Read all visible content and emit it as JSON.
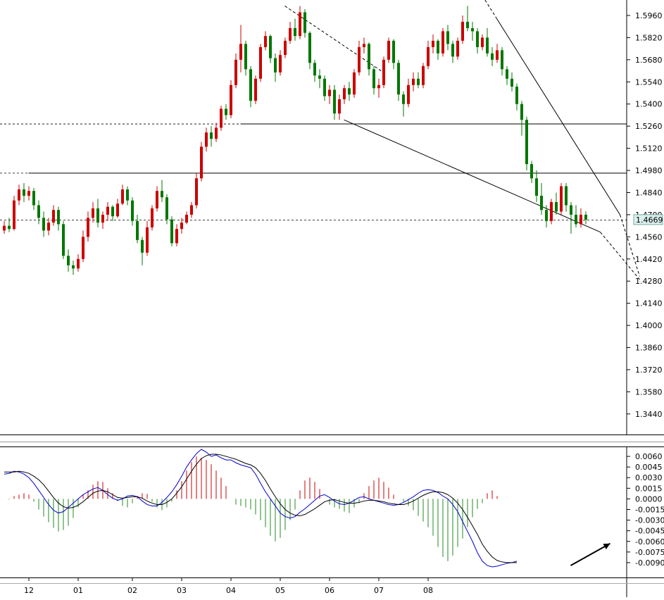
{
  "chart_data": [
    {
      "type": "candlestick",
      "panel": "price",
      "y_ticks": [
        1.596,
        1.582,
        1.568,
        1.554,
        1.54,
        1.526,
        1.512,
        1.498,
        1.484,
        1.47,
        1.456,
        1.442,
        1.428,
        1.414,
        1.4,
        1.386,
        1.372,
        1.358,
        1.344
      ],
      "ylim": [
        1.331,
        1.604
      ],
      "last_price": 1.4669,
      "last_price_label": "1.4669",
      "up_color": "#cc0000",
      "down_color": "#007700",
      "levels": [
        {
          "value": 1.5276,
          "style": "solid-then-dashed",
          "start_index": 48
        },
        {
          "value": 1.4965,
          "style": "solid-then-dashed",
          "start_index": 5
        },
        {
          "value": 1.4669,
          "style": "dashed",
          "start_index": 0
        }
      ],
      "trendlines": [
        {
          "from": [
            69,
            1.53
          ],
          "to": [
            121,
            1.459
          ],
          "extend_to": [
            129,
            1.429
          ],
          "extension": "dashed"
        },
        {
          "from": [
            100,
            1.594
          ],
          "to": [
            125,
            1.47
          ],
          "extend_to": [
            129,
            1.431
          ],
          "extension": "dashed",
          "lead_in": "dashed"
        },
        {
          "from": [
            57,
            1.602
          ],
          "to": [
            77,
            1.56
          ],
          "style": "dashed"
        }
      ],
      "ohlc": [
        [
          1.46,
          1.466,
          1.458,
          1.463
        ],
        [
          1.463,
          1.468,
          1.459,
          1.461
        ],
        [
          1.461,
          1.482,
          1.46,
          1.479
        ],
        [
          1.479,
          1.489,
          1.476,
          1.486
        ],
        [
          1.486,
          1.49,
          1.478,
          1.482
        ],
        [
          1.482,
          1.488,
          1.479,
          1.485
        ],
        [
          1.485,
          1.487,
          1.473,
          1.476
        ],
        [
          1.476,
          1.479,
          1.464,
          1.468
        ],
        [
          1.468,
          1.472,
          1.456,
          1.46
        ],
        [
          1.46,
          1.468,
          1.457,
          1.465
        ],
        [
          1.465,
          1.476,
          1.463,
          1.473
        ],
        [
          1.473,
          1.475,
          1.46,
          1.464
        ],
        [
          1.464,
          1.466,
          1.442,
          1.444
        ],
        [
          1.444,
          1.448,
          1.434,
          1.438
        ],
        [
          1.438,
          1.441,
          1.432,
          1.436
        ],
        [
          1.436,
          1.445,
          1.434,
          1.442
        ],
        [
          1.442,
          1.46,
          1.44,
          1.456
        ],
        [
          1.456,
          1.472,
          1.453,
          1.468
        ],
        [
          1.468,
          1.478,
          1.465,
          1.474
        ],
        [
          1.474,
          1.48,
          1.462,
          1.465
        ],
        [
          1.465,
          1.472,
          1.461,
          1.47
        ],
        [
          1.47,
          1.478,
          1.466,
          1.475
        ],
        [
          1.475,
          1.476,
          1.466,
          1.469
        ],
        [
          1.469,
          1.48,
          1.468,
          1.477
        ],
        [
          1.477,
          1.489,
          1.476,
          1.486
        ],
        [
          1.486,
          1.488,
          1.476,
          1.479
        ],
        [
          1.479,
          1.481,
          1.463,
          1.466
        ],
        [
          1.466,
          1.47,
          1.452,
          1.454
        ],
        [
          1.454,
          1.456,
          1.438,
          1.446
        ],
        [
          1.446,
          1.466,
          1.444,
          1.462
        ],
        [
          1.462,
          1.476,
          1.46,
          1.474
        ],
        [
          1.474,
          1.488,
          1.472,
          1.485
        ],
        [
          1.485,
          1.492,
          1.478,
          1.481
        ],
        [
          1.481,
          1.483,
          1.464,
          1.467
        ],
        [
          1.467,
          1.469,
          1.45,
          1.452
        ],
        [
          1.452,
          1.464,
          1.45,
          1.461
        ],
        [
          1.461,
          1.468,
          1.458,
          1.465
        ],
        [
          1.465,
          1.472,
          1.464,
          1.47
        ],
        [
          1.47,
          1.478,
          1.468,
          1.476
        ],
        [
          1.476,
          1.496,
          1.474,
          1.493
        ],
        [
          1.493,
          1.516,
          1.491,
          1.513
        ],
        [
          1.513,
          1.525,
          1.51,
          1.522
        ],
        [
          1.522,
          1.526,
          1.513,
          1.518
        ],
        [
          1.518,
          1.528,
          1.516,
          1.525
        ],
        [
          1.525,
          1.539,
          1.523,
          1.537
        ],
        [
          1.537,
          1.54,
          1.53,
          1.533
        ],
        [
          1.533,
          1.555,
          1.531,
          1.552
        ],
        [
          1.552,
          1.572,
          1.55,
          1.568
        ],
        [
          1.568,
          1.59,
          1.56,
          1.578
        ],
        [
          1.578,
          1.58,
          1.558,
          1.562
        ],
        [
          1.562,
          1.564,
          1.538,
          1.542
        ],
        [
          1.542,
          1.558,
          1.54,
          1.556
        ],
        [
          1.556,
          1.578,
          1.554,
          1.576
        ],
        [
          1.576,
          1.586,
          1.574,
          1.583
        ],
        [
          1.583,
          1.584,
          1.566,
          1.569
        ],
        [
          1.569,
          1.572,
          1.554,
          1.56
        ],
        [
          1.56,
          1.574,
          1.558,
          1.571
        ],
        [
          1.571,
          1.582,
          1.569,
          1.58
        ],
        [
          1.58,
          1.592,
          1.578,
          1.588
        ],
        [
          1.588,
          1.594,
          1.58,
          1.583
        ],
        [
          1.583,
          1.602,
          1.581,
          1.598
        ],
        [
          1.598,
          1.6,
          1.582,
          1.585
        ],
        [
          1.585,
          1.586,
          1.562,
          1.566
        ],
        [
          1.566,
          1.568,
          1.554,
          1.558
        ],
        [
          1.558,
          1.562,
          1.55,
          1.556
        ],
        [
          1.556,
          1.558,
          1.542,
          1.545
        ],
        [
          1.545,
          1.552,
          1.54,
          1.549
        ],
        [
          1.549,
          1.552,
          1.53,
          1.534
        ],
        [
          1.534,
          1.546,
          1.53,
          1.543
        ],
        [
          1.543,
          1.552,
          1.54,
          1.55
        ],
        [
          1.55,
          1.554,
          1.542,
          1.546
        ],
        [
          1.546,
          1.562,
          1.544,
          1.56
        ],
        [
          1.56,
          1.58,
          1.558,
          1.576
        ],
        [
          1.576,
          1.582,
          1.572,
          1.578
        ],
        [
          1.578,
          1.579,
          1.558,
          1.562
        ],
        [
          1.562,
          1.564,
          1.546,
          1.55
        ],
        [
          1.55,
          1.556,
          1.544,
          1.552
        ],
        [
          1.552,
          1.57,
          1.55,
          1.568
        ],
        [
          1.568,
          1.582,
          1.566,
          1.58
        ],
        [
          1.58,
          1.581,
          1.562,
          1.566
        ],
        [
          1.566,
          1.568,
          1.542,
          1.546
        ],
        [
          1.546,
          1.548,
          1.532,
          1.54
        ],
        [
          1.54,
          1.556,
          1.538,
          1.552
        ],
        [
          1.552,
          1.56,
          1.548,
          1.556
        ],
        [
          1.556,
          1.56,
          1.55,
          1.552
        ],
        [
          1.552,
          1.566,
          1.55,
          1.564
        ],
        [
          1.564,
          1.58,
          1.562,
          1.576
        ],
        [
          1.576,
          1.584,
          1.572,
          1.58
        ],
        [
          1.58,
          1.581,
          1.568,
          1.572
        ],
        [
          1.572,
          1.588,
          1.57,
          1.586
        ],
        [
          1.586,
          1.59,
          1.574,
          1.578
        ],
        [
          1.578,
          1.58,
          1.566,
          1.57
        ],
        [
          1.57,
          1.582,
          1.568,
          1.58
        ],
        [
          1.58,
          1.596,
          1.578,
          1.592
        ],
        [
          1.592,
          1.602,
          1.586,
          1.588
        ],
        [
          1.588,
          1.592,
          1.58,
          1.586
        ],
        [
          1.586,
          1.588,
          1.572,
          1.576
        ],
        [
          1.576,
          1.584,
          1.574,
          1.582
        ],
        [
          1.582,
          1.588,
          1.57,
          1.572
        ],
        [
          1.572,
          1.576,
          1.564,
          1.568
        ],
        [
          1.568,
          1.578,
          1.566,
          1.574
        ],
        [
          1.574,
          1.576,
          1.558,
          1.562
        ],
        [
          1.562,
          1.564,
          1.552,
          1.556
        ],
        [
          1.556,
          1.56,
          1.548,
          1.551
        ],
        [
          1.551,
          1.553,
          1.536,
          1.54
        ],
        [
          1.54,
          1.542,
          1.52,
          1.53
        ],
        [
          1.53,
          1.532,
          1.498,
          1.502
        ],
        [
          1.502,
          1.504,
          1.49,
          1.493
        ],
        [
          1.493,
          1.498,
          1.478,
          1.482
        ],
        [
          1.482,
          1.49,
          1.47,
          1.473
        ],
        [
          1.473,
          1.476,
          1.462,
          1.466
        ],
        [
          1.466,
          1.48,
          1.464,
          1.478
        ],
        [
          1.478,
          1.484,
          1.47,
          1.472
        ],
        [
          1.472,
          1.49,
          1.47,
          1.488
        ],
        [
          1.488,
          1.49,
          1.472,
          1.476
        ],
        [
          1.476,
          1.478,
          1.458,
          1.47
        ],
        [
          1.47,
          1.476,
          1.462,
          1.464
        ],
        [
          1.464,
          1.474,
          1.462,
          1.47
        ],
        [
          1.47,
          1.472,
          1.464,
          1.4669
        ]
      ],
      "x_ticks": [
        {
          "label": "12",
          "index": 5
        },
        {
          "label": "01",
          "index": 15
        },
        {
          "label": "02",
          "index": 26
        },
        {
          "label": "03",
          "index": 36
        },
        {
          "label": "04",
          "index": 46
        },
        {
          "label": "05",
          "index": 56
        },
        {
          "label": "06",
          "index": 66
        },
        {
          "label": "07",
          "index": 76
        },
        {
          "label": "08",
          "index": 86
        }
      ]
    },
    {
      "type": "macd",
      "panel": "indicator",
      "y_ticks": [
        0.006,
        0.0045,
        0.003,
        0.0015,
        0.0,
        -0.0015,
        -0.003,
        -0.0045,
        -0.006,
        -0.0075,
        -0.009
      ],
      "ylim": [
        -0.0103,
        0.0072
      ],
      "histogram_up_color": "#cc0000",
      "histogram_down_color": "#228b22",
      "series": [
        {
          "role": "macd",
          "color": "#0000cc",
          "values": [
            0.0035,
            0.0036,
            0.0039,
            0.0038,
            0.0035,
            0.003,
            0.0022,
            0.0012,
            0.0002,
            -0.0008,
            -0.0016,
            -0.002,
            -0.0018,
            -0.0012,
            -0.0006,
            0.0,
            0.0006,
            0.001,
            0.0014,
            0.0016,
            0.0012,
            0.0006,
            0.0001,
            -0.0002,
            0.0,
            0.0004,
            0.0005,
            0.0003,
            -0.0003,
            -0.0008,
            -0.001,
            -0.001,
            -0.0005,
            0.0002,
            0.001,
            0.002,
            0.0032,
            0.0045,
            0.0055,
            0.0064,
            0.007,
            0.0066,
            0.006,
            0.0062,
            0.0058,
            0.0055,
            0.0055,
            0.0051,
            0.0048,
            0.0046,
            0.0044,
            0.0035,
            0.0022,
            0.001,
            0.0,
            -0.001,
            -0.002,
            -0.0025,
            -0.0027,
            -0.0025,
            -0.0019,
            -0.0014,
            -0.0008,
            -0.0002,
            0.0004,
            0.0006,
            0.0002,
            -0.0003,
            -0.0007,
            -0.0008,
            -0.0006,
            -0.0002,
            0.0002,
            0.0003,
            0.0,
            -0.0002,
            -0.0004,
            -0.0006,
            -0.0008,
            -0.0009,
            -0.0008,
            -0.0005,
            -0.0001,
            0.0003,
            0.0008,
            0.0012,
            0.0013,
            0.0012,
            0.0009,
            0.0004,
            0.0,
            -0.0008,
            -0.0018,
            -0.0032,
            -0.0046,
            -0.006,
            -0.0076,
            -0.0088,
            -0.0094,
            -0.0096,
            -0.0095,
            -0.0093,
            -0.0091,
            -0.009,
            -0.0088
          ]
        },
        {
          "role": "signal",
          "color": "#000000",
          "values": [
            0.0038,
            0.0038,
            0.0038,
            0.0039,
            0.0038,
            0.0036,
            0.0032,
            0.0027,
            0.002,
            0.0011,
            0.0002,
            -0.0006,
            -0.0011,
            -0.0013,
            -0.0012,
            -0.0009,
            -0.0004,
            0.0002,
            0.0008,
            0.0011,
            0.0012,
            0.001,
            0.0006,
            0.0002,
            0.0001,
            0.0002,
            0.0003,
            0.0003,
            0.0001,
            -0.0003,
            -0.0006,
            -0.0008,
            -0.0008,
            -0.0005,
            0.0,
            0.0008,
            0.0017,
            0.0028,
            0.0039,
            0.0049,
            0.0057,
            0.0061,
            0.0063,
            0.0063,
            0.0062,
            0.006,
            0.0058,
            0.0056,
            0.0053,
            0.005,
            0.0048,
            0.0044,
            0.0036,
            0.0026,
            0.0014,
            0.0003,
            -0.0007,
            -0.0015,
            -0.002,
            -0.0023,
            -0.0024,
            -0.0022,
            -0.0018,
            -0.0014,
            -0.0009,
            -0.0004,
            -0.0002,
            -0.0001,
            -0.0003,
            -0.0005,
            -0.0006,
            -0.0006,
            -0.0005,
            -0.0003,
            -0.0002,
            -0.0002,
            -0.0003,
            -0.0004,
            -0.0006,
            -0.0007,
            -0.0008,
            -0.0008,
            -0.0006,
            -0.0003,
            0.0001,
            0.0005,
            0.0008,
            0.001,
            0.001,
            0.0009,
            0.0006,
            0.0001,
            -0.0006,
            -0.0015,
            -0.0026,
            -0.0038,
            -0.005,
            -0.0064,
            -0.0074,
            -0.0082,
            -0.0087,
            -0.0089,
            -0.009,
            -0.009,
            -0.009
          ]
        },
        {
          "role": "histogram",
          "values": [
            0.0,
            -0.0001,
            0.0004,
            0.0006,
            0.0008,
            0.0006,
            -0.0004,
            -0.0015,
            -0.0025,
            -0.0033,
            -0.0041,
            -0.0046,
            -0.0044,
            -0.0038,
            -0.0027,
            -0.0012,
            0.0006,
            0.0012,
            0.002,
            0.0025,
            0.0024,
            0.0015,
            0.0008,
            -0.0003,
            -0.001,
            -0.0012,
            -0.0006,
            0.0004,
            0.0008,
            0.0007,
            -0.0004,
            -0.0012,
            -0.0016,
            -0.0012,
            -0.0004,
            0.0012,
            0.0025,
            0.004,
            0.0052,
            0.006,
            0.0058,
            0.0055,
            0.0049,
            0.004,
            0.003,
            0.0018,
            0.0,
            -0.0008,
            -0.001,
            -0.0012,
            -0.0015,
            -0.0022,
            -0.003,
            -0.004,
            -0.0052,
            -0.006,
            -0.0055,
            -0.0044,
            -0.003,
            -0.0015,
            0.0012,
            0.0026,
            0.003,
            0.0024,
            0.0014,
            0.0,
            -0.0008,
            -0.0012,
            -0.0014,
            -0.0018,
            -0.002,
            -0.0012,
            -0.0006,
            0.0008,
            0.0018,
            0.0026,
            0.003,
            0.0024,
            0.0016,
            0.0006,
            0.0,
            -0.0004,
            -0.001,
            -0.0016,
            -0.0024,
            -0.0032,
            -0.004,
            -0.0052,
            -0.0068,
            -0.0082,
            -0.0088,
            -0.008,
            -0.0068,
            -0.0056,
            -0.004,
            -0.0026,
            -0.0014,
            -0.0006,
            0.0008,
            0.0012,
            0.0004
          ]
        }
      ]
    }
  ],
  "annotation": {
    "type": "arrow",
    "direction": "up-right",
    "color": "#000000"
  }
}
